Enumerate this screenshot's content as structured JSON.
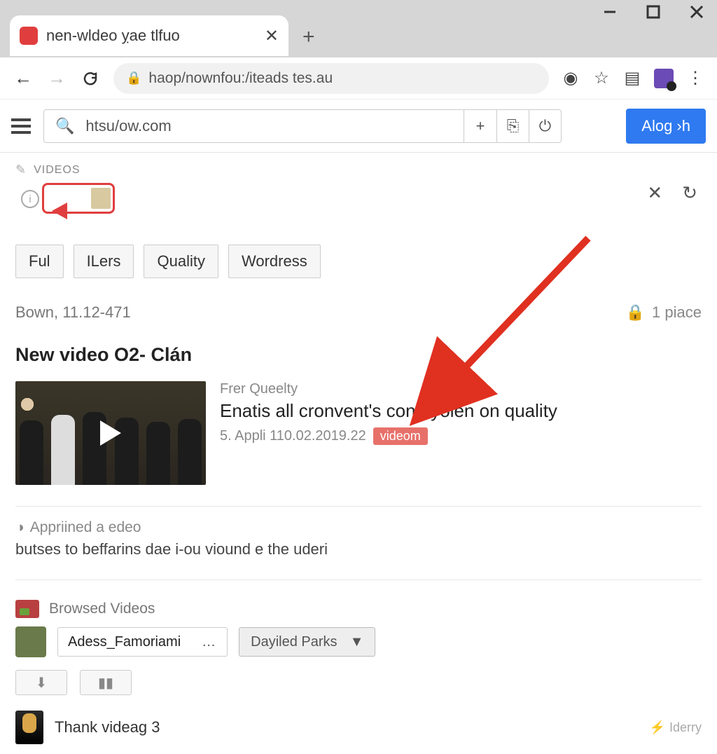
{
  "browser": {
    "tab_title": "nen-wldeo ỵae tlfuo",
    "url": "haop/nownfou:/iteads tes.au"
  },
  "appbar": {
    "search_value": "htsu/ow.com",
    "login_label": "Alog ›h"
  },
  "section": {
    "label": "VIDEOS"
  },
  "filters": [
    "Ful",
    "ILers",
    "Quality",
    "Wordress"
  ],
  "meta": {
    "left": "Bown, 11.12-471",
    "place": "1 piace"
  },
  "heading": "New video O2- Clán",
  "video": {
    "overline": "Frer Queelty",
    "title": "Enatis all cronvent's cone yolen on quality",
    "date": "5. Appli 110.02.2019.22",
    "tag": "videom"
  },
  "approved": {
    "label": "Appriined a edeo",
    "text": "butses to beffarins dae i-ou viound e the uderi"
  },
  "browsed": {
    "header": "Browsed Videos",
    "input": "Adess_Famoriami",
    "dropdown": "Dayiled Parks"
  },
  "thank": {
    "text": "Thank videag 3",
    "right": "Iderry"
  }
}
